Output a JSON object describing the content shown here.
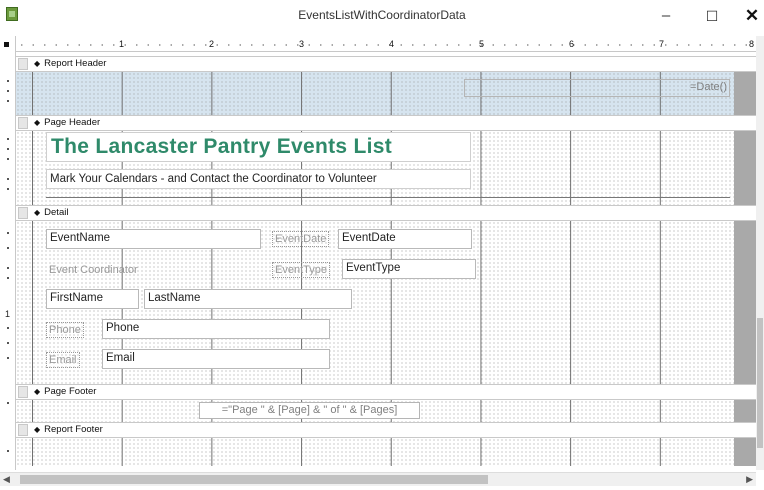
{
  "window": {
    "title": "EventsListWithCoordinatorData",
    "minimize": "–",
    "maximize": "☐",
    "close": "✕"
  },
  "ruler": {
    "numbers": [
      "1",
      "2",
      "3",
      "4",
      "5",
      "6",
      "7",
      "8"
    ]
  },
  "vruler": {
    "one": "1"
  },
  "sections": {
    "report_header": "Report Header",
    "page_header": "Page Header",
    "detail": "Detail",
    "page_footer": "Page Footer",
    "report_footer": "Report Footer"
  },
  "report_header": {
    "date_control": "=Date()"
  },
  "page_header": {
    "title": "The Lancaster Pantry Events List",
    "subtitle": "Mark Your Calendars - and Contact the Coordinator to Volunteer"
  },
  "detail": {
    "event_name": "EventName",
    "event_date_label": "EventDate",
    "event_date": "EventDate",
    "event_coordinator_label": "Event Coordinator",
    "event_type_label": "EventType",
    "event_type": "EventType",
    "first_name": "FirstName",
    "last_name": "LastName",
    "phone_label": "Phone",
    "phone": "Phone",
    "email_label": "Email",
    "email": "Email"
  },
  "page_footer": {
    "page_expression": "=\"Page \" & [Page] & \" of \" & [Pages]"
  },
  "colors": {
    "title_green": "#2f8a6a",
    "header_blue": "#d6e4ef"
  }
}
